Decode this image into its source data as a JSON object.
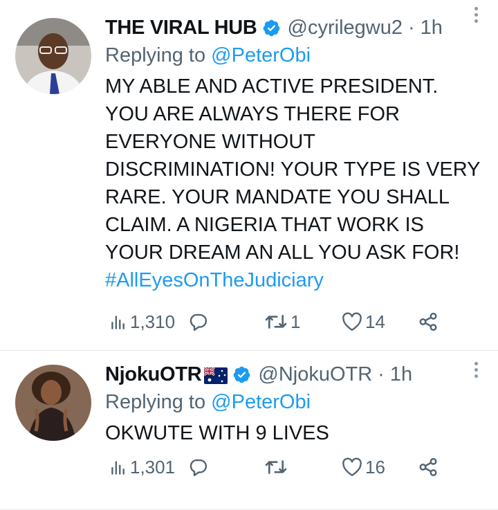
{
  "tweets": [
    {
      "display_name": "THE VIRAL HUB",
      "handle": "@cyrilegwu2",
      "separator": "·",
      "time": "1h",
      "replying_prefix": "Replying to",
      "replying_to": "@PeterObi",
      "text": "MY ABLE AND ACTIVE PRESIDENT. YOU ARE ALWAYS THERE FOR EVERYONE WITHOUT DISCRIMINATION! YOUR TYPE IS VERY RARE. YOUR MANDATE YOU SHALL CLAIM. A NIGERIA THAT WORK IS YOUR DREAM AN ALL YOU ASK FOR!",
      "hashtag": "#AllEyesOnTheJudiciary",
      "views": "1,310",
      "replies": "",
      "retweets": "1",
      "likes": "14"
    },
    {
      "display_name": "NjokuOTR",
      "handle": "@NjokuOTR",
      "separator": "·",
      "time": "1h",
      "replying_prefix": "Replying to",
      "replying_to": "@PeterObi",
      "text": "OKWUTE WITH 9 LIVES",
      "views": "1,301",
      "replies": "",
      "retweets": "",
      "likes": "16"
    }
  ],
  "icons": {
    "verified": "verified-badge-icon",
    "more": "more-vertical-icon",
    "views": "views-bar-chart-icon",
    "reply": "reply-bubble-icon",
    "retweet": "retweet-icon",
    "like": "heart-icon",
    "share": "share-icon",
    "flag": "australia-flag-icon"
  },
  "colors": {
    "link": "#1d9bf0",
    "secondary_text": "#536471",
    "verified": "#1d9bf0"
  }
}
